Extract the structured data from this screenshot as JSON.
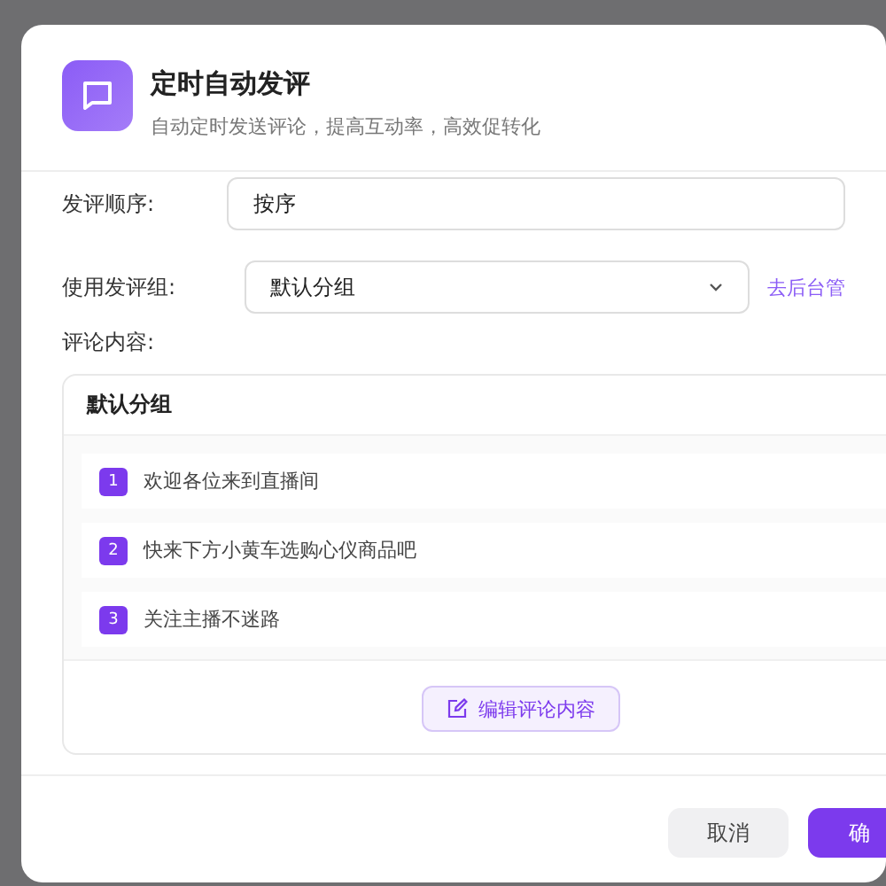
{
  "dialog": {
    "title": "定时自动发评",
    "subtitle": "自动定时发送评论，提高互动率，高效促转化"
  },
  "fields": [
    {
      "kind": "input",
      "label": "发评顺序:",
      "value": "按序"
    },
    {
      "kind": "select",
      "label": "使用发评组:",
      "value": "默认分组",
      "link": "去后台管"
    }
  ],
  "content": {
    "label": "评论内容:",
    "group": "默认分组",
    "comments": [
      {
        "number": "1",
        "text": "欢迎各位来到直播间"
      },
      {
        "number": "2",
        "text": "快来下方小黄车选购心仪商品吧"
      },
      {
        "number": "3",
        "text": "关注主播不迷路"
      }
    ],
    "edit_button": "编辑评论内容"
  },
  "footer": {
    "cancel": "取消",
    "confirm": "确"
  }
}
